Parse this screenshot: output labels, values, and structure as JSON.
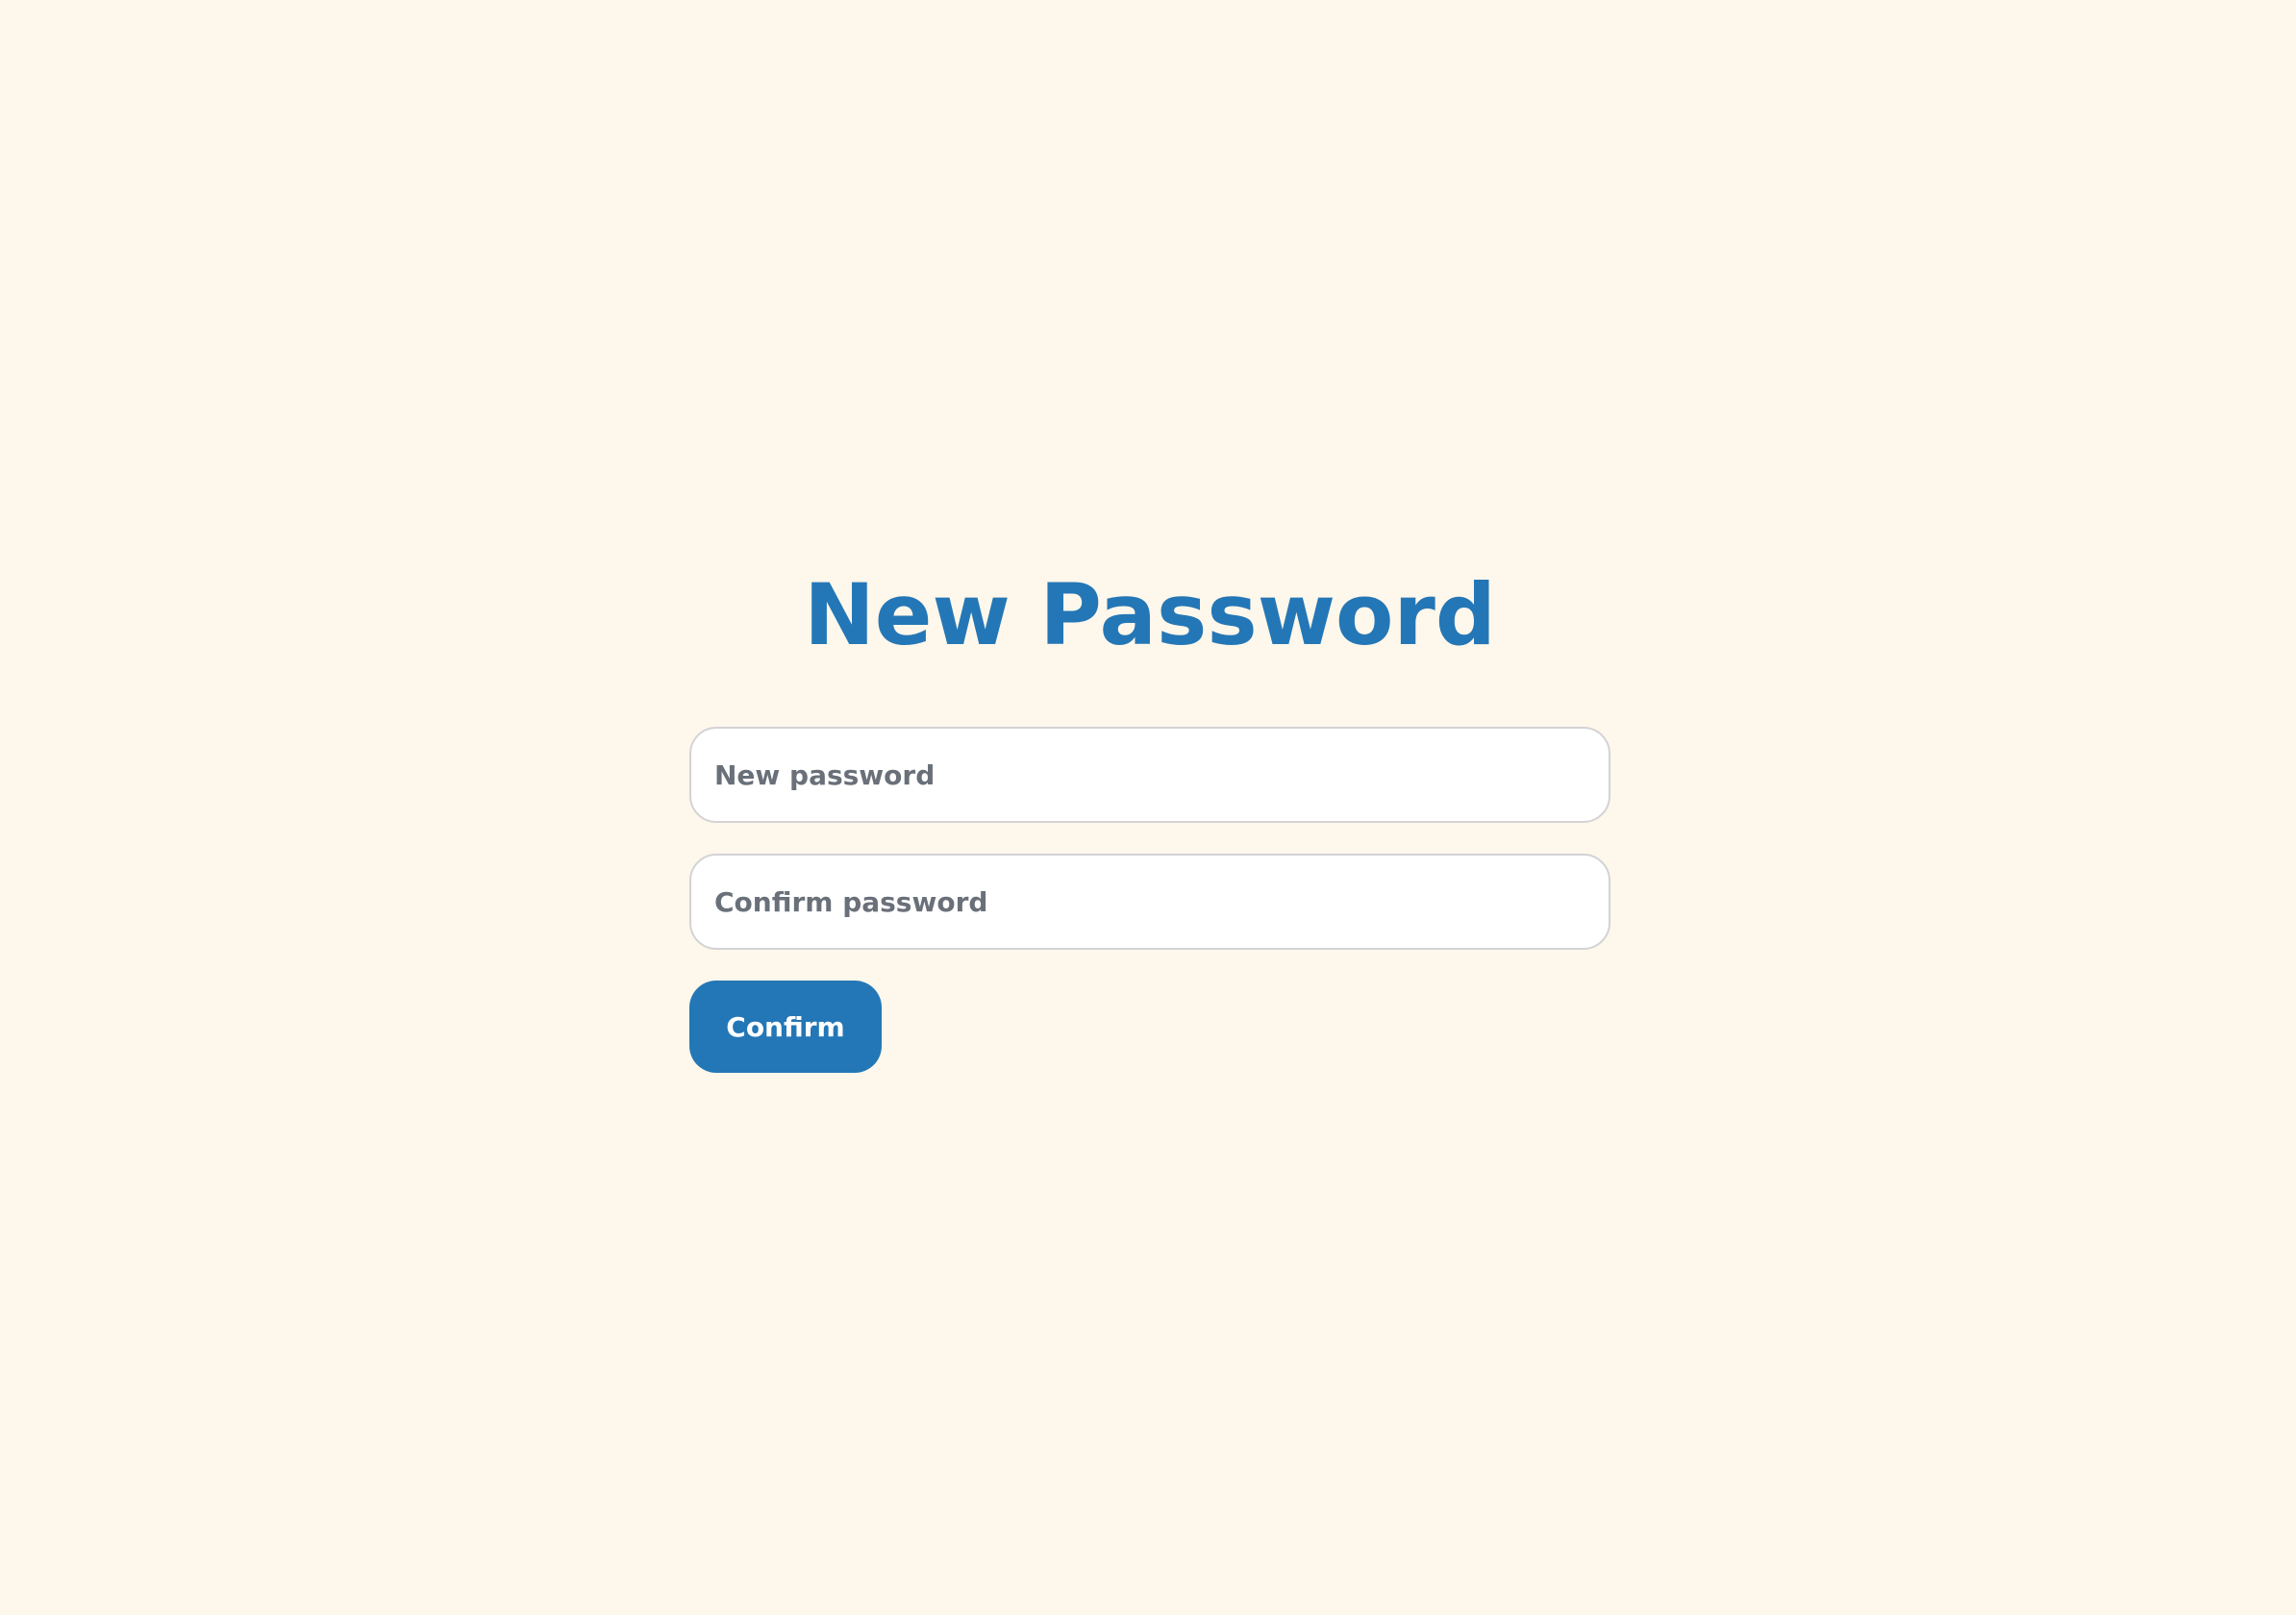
{
  "page": {
    "title": "New Password"
  },
  "form": {
    "new_password": {
      "placeholder": "New password",
      "value": ""
    },
    "confirm_password": {
      "placeholder": "Confirm password",
      "value": ""
    },
    "confirm_label": "Confirm"
  },
  "colors": {
    "background": "#fef7eb",
    "accent": "#2477b6",
    "input_border": "#d3d3d6",
    "placeholder": "#6a7079"
  }
}
